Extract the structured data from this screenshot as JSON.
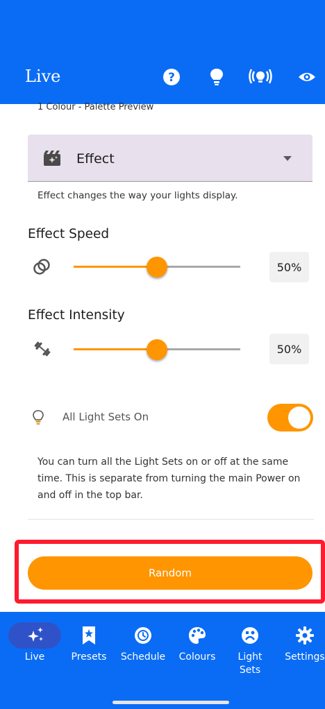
{
  "topbar": {
    "title": "Live",
    "icons": [
      "help-icon",
      "bulb-icon",
      "broadcast-icon",
      "eye-icon"
    ]
  },
  "palette_preview": "1 Colour - Palette Preview",
  "effect": {
    "label": "Effect",
    "icon": "movie-sparkle-icon",
    "helper": "Effect changes the way your lights display."
  },
  "effect_speed": {
    "title": "Effect Speed",
    "icon": "rings-icon",
    "value": "50%",
    "level": 0.5
  },
  "effect_intensity": {
    "title": "Effect Intensity",
    "icon": "dumbbell-icon",
    "value": "50%",
    "level": 0.5
  },
  "all_light_sets": {
    "label": "All Light Sets On",
    "icon": "bulb-outline-icon",
    "on": true,
    "description": "You can turn all the Light Sets on or off at the same time. This is separate from turning the main Power on and off in the top bar."
  },
  "random_button": "Random",
  "nav": {
    "items": [
      {
        "label": "Live",
        "icon": "sparkles-icon",
        "active": true
      },
      {
        "label": "Presets",
        "icon": "bookmark-star-icon"
      },
      {
        "label": "Schedule",
        "icon": "clock-icon"
      },
      {
        "label": "Colours",
        "icon": "palette-icon"
      },
      {
        "label": "Light Sets",
        "icon": "light-sets-icon"
      },
      {
        "label": "Settings",
        "icon": "gear-icon"
      }
    ]
  },
  "colors": {
    "primary": "#0a6cf5",
    "accent": "#ff9500",
    "highlight": "#ff1a2e"
  }
}
